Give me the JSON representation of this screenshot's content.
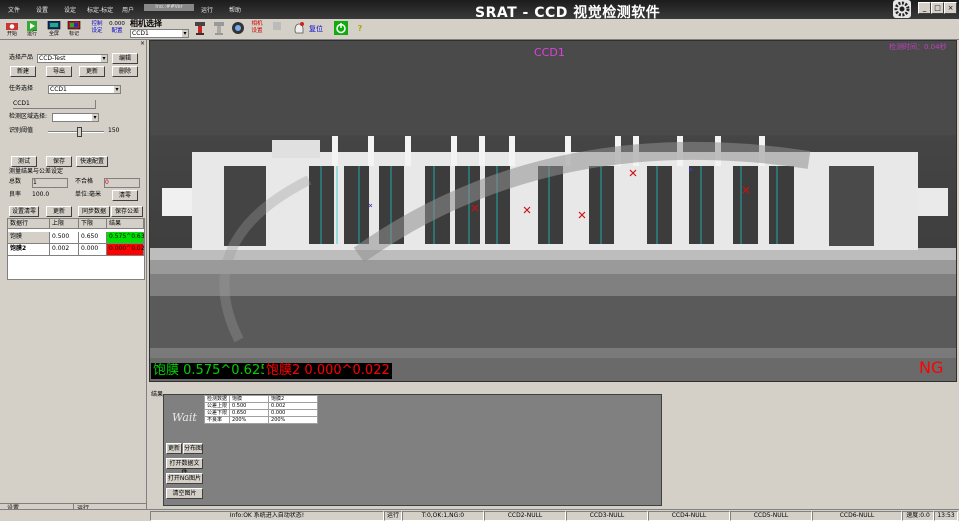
{
  "window": {
    "title": "SRAT - CCD 视觉检测软件",
    "minimize": "_",
    "maximize": "□",
    "close": "×"
  },
  "menu": [
    "文件",
    "设置",
    "设定",
    "标定-标定",
    "用户",
    "运行",
    "帮助"
  ],
  "menu_field": "Ino.:##Ver",
  "toolbar": {
    "items": [
      {
        "label": "开始",
        "icon": "camera-icon"
      },
      {
        "label": "运行",
        "icon": "play-icon"
      },
      {
        "label": "全屏",
        "icon": "monitor-icon"
      },
      {
        "label": "标记",
        "icon": "monitor-color-icon"
      }
    ],
    "control_top": "控制",
    "control_bottom": "设定",
    "value_top": "0.000",
    "value_bottom": "配置",
    "camera_select_label": "相机选择",
    "camera_select_value": "CCD1",
    "cam_settings_top": "相机",
    "cam_settings_bottom": "设置",
    "gray_label_top": "复位",
    "reset_label": "复位",
    "help_icon": "?"
  },
  "left": {
    "product_label": "选择产品",
    "product_value": "CCD-Test",
    "edit_button": "编辑",
    "new_button": "新建",
    "export_button": "导出",
    "update_button": "更新",
    "delete_button": "删除",
    "task_label": "任务选择",
    "task_value": "CCD1",
    "ccd_field": "CCD1",
    "region_label": "检测区域选择:",
    "region_value": "",
    "threshold_label": "识别阈值",
    "threshold_value": "150",
    "threshold_level": 0.55,
    "test_button": "测试",
    "save_button": "保存",
    "quick_config_button": "快速配置",
    "section_title": "测量结果与公差设定",
    "total_label": "总数",
    "total_value": "1",
    "fail_label": "不合格",
    "fail_value": "0",
    "yield_label": "良率",
    "yield_value": "100.0",
    "unit_label": "单位:毫米",
    "clear_button": "清零",
    "set_clear_button": "设置清零",
    "update2_button": "更新",
    "sync_button": "同步数据",
    "save_tol_button": "保存公差",
    "table": {
      "headers": [
        "数据行",
        "上限",
        "下限",
        "结果"
      ],
      "rows": [
        {
          "name": "饱膜",
          "upper": "0.500",
          "lower": "0.650",
          "result": "0.575^0.63",
          "result_color": "#00e000"
        },
        {
          "name": "饱膜2",
          "upper": "0.002",
          "lower": "0.000",
          "result": "0.000^0.02",
          "result_color": "#ff0000"
        }
      ]
    },
    "tabs": [
      "设置",
      "运行"
    ]
  },
  "camera": {
    "label": "CCD1",
    "topright": "检测时间：0.04秒",
    "result": "NG",
    "measure1_label": "饱膜",
    "measure1_value": "0.575^0.625",
    "measure2_label": "饱膜2",
    "measure2_value": "0.000^0.022",
    "watermark": "世界"
  },
  "bottom": {
    "frame_label": "结果",
    "wait_text": "Wait",
    "update_button": "更新",
    "chart_button": "分布图",
    "open_data_button": "打开数据文件",
    "open_ng_button": "打开NG图片",
    "clear_button": "清空图片",
    "result_table": {
      "headers": [
        "检测数据",
        "饱膜",
        "饱膜2"
      ],
      "rows": [
        [
          "公差上限",
          "0.500",
          "0.002"
        ],
        [
          "公差下限",
          "0.650",
          "0.000"
        ],
        [
          "不良率",
          "200%",
          "200%"
        ]
      ]
    }
  },
  "status": {
    "info": "Info:OK 系统进入自动状态!",
    "run": "运行",
    "counts": "T:0,OK:1,NG:0",
    "ccd2": "CCD2-NULL",
    "ccd3": "CCD3-NULL",
    "ccd4": "CCD4-NULL",
    "ccd5": "CCD5-NULL",
    "ccd6": "CCD6-NULL",
    "speed": "速度:0.0",
    "time": "13:53"
  }
}
